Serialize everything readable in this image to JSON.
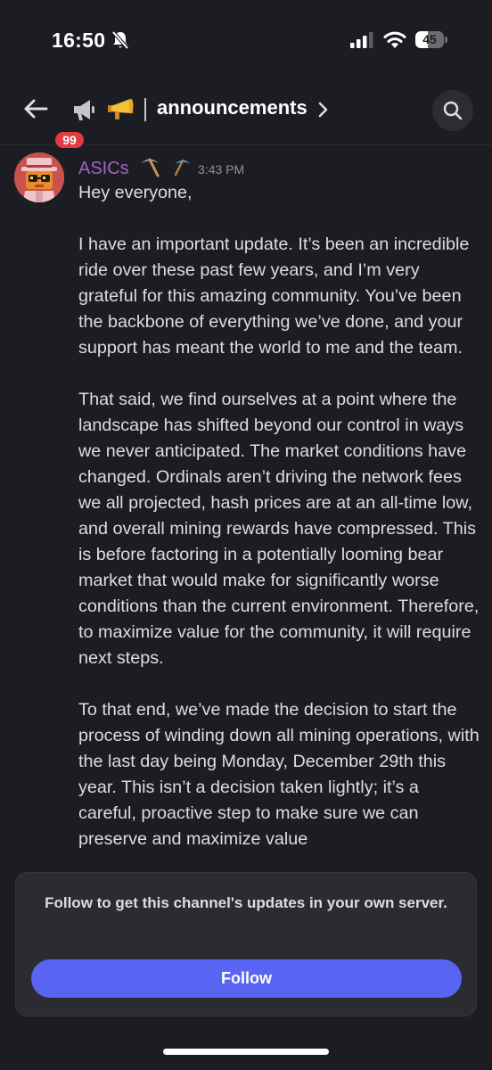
{
  "status_bar": {
    "time": "16:50",
    "battery_level": "45",
    "icons": [
      "bell-off-icon",
      "signal-icon",
      "wifi-icon",
      "battery-icon"
    ]
  },
  "header": {
    "unread_count": "99",
    "channel_emoji": "megaphone",
    "channel_name": "announcements",
    "icons": [
      "back-arrow-icon",
      "announcement-channel-icon",
      "chevron-right-icon",
      "search-icon"
    ]
  },
  "message": {
    "author": "ASICs",
    "author_color": "#a560c9",
    "author_icons": [
      "pickaxe-icon",
      "pickaxe-icon"
    ],
    "timestamp": "3:43 PM",
    "paragraphs": [
      "Hey everyone,",
      "I have an important update. It’s been an incredible ride over these past few years, and I’m very grateful for this amazing community. You’ve been the backbone of everything we’ve done, and your support has meant the world to me and the team.",
      "That said, we find ourselves at a point where the landscape has shifted beyond our control in ways we never anticipated. The market conditions have changed. Ordinals aren’t driving the network fees we all projected, hash prices are at an all-time low, and overall mining rewards have compressed. This is before factoring in a potentially looming bear market that would make for significantly worse conditions than the current environment. Therefore, to maximize value for the community, it will require next steps.",
      "To that end, we’ve made the decision to start the process of winding down all mining operations, with the last day being Monday, December 29th this year. This isn’t a decision taken lightly; it’s a careful, proactive step to make sure we can preserve and maximize value"
    ]
  },
  "follow_card": {
    "prompt": "Follow to get this channel's updates in your own server.",
    "button_label": "Follow",
    "button_color": "#5865f2"
  },
  "colors": {
    "background": "#1c1d22",
    "badge": "#e23b41",
    "text": "#dbdee1",
    "timestamp": "#8e9297"
  }
}
